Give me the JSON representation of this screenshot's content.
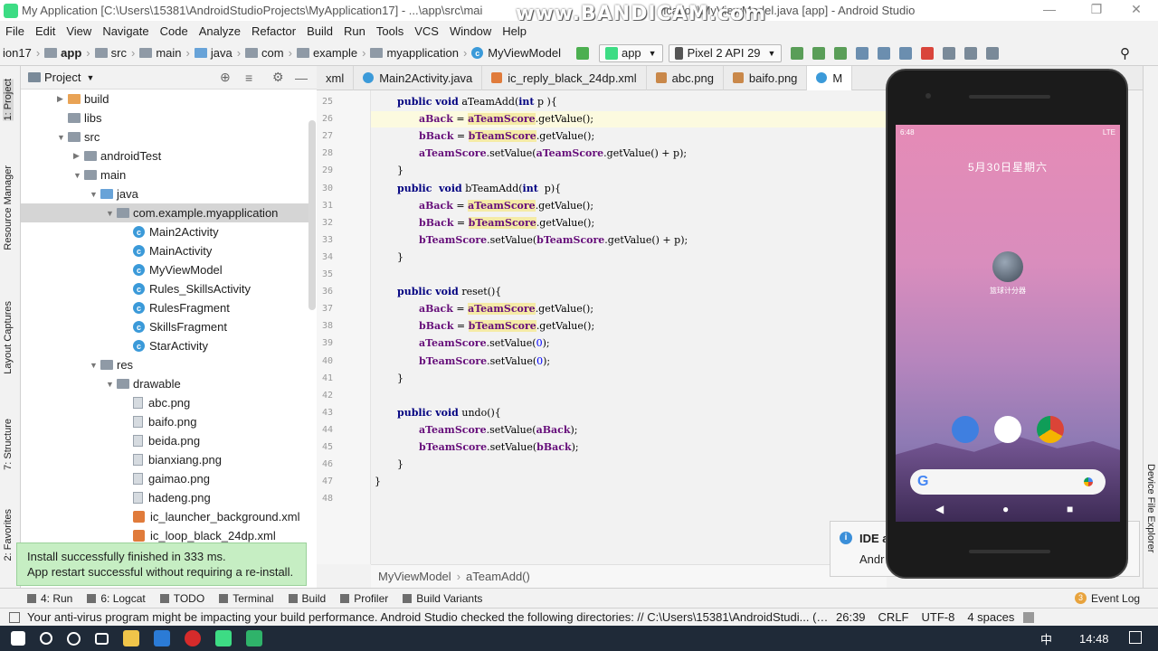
{
  "window": {
    "title": "My Application [C:\\Users\\15381\\AndroidStudioProjects\\MyApplication17] - ...\\app\\src\\main\\java\\com\\example\\myapplication\\MyViewModel.java [app] - Android Studio",
    "title_left": "My Application [C:\\Users\\15381\\AndroidStudioProjects\\MyApplication17] - ...\\app\\src\\mai",
    "title_right": "ication\\MyViewModel.java [app] - Android Studio",
    "watermark": "www.BANDICAM.com"
  },
  "menu": [
    "File",
    "Edit",
    "View",
    "Navigate",
    "Code",
    "Analyze",
    "Refactor",
    "Build",
    "Run",
    "Tools",
    "VCS",
    "Window",
    "Help"
  ],
  "nav": {
    "crumbs": [
      "ion17",
      "app",
      "src",
      "main",
      "java",
      "com",
      "example",
      "myapplication",
      "MyViewModel"
    ],
    "run_config": "app",
    "device": "Pixel 2 API 29"
  },
  "left_tool_tabs": [
    "1: Project",
    "Resource Manager",
    "Layout Captures",
    "7: Structure",
    "2: Favorites"
  ],
  "project_panel": {
    "title": "Project",
    "rows": [
      {
        "label": "build",
        "indent": 0,
        "kind": "folder-orange",
        "arrow": "▶"
      },
      {
        "label": "libs",
        "indent": 0,
        "kind": "folder",
        "arrow": ""
      },
      {
        "label": "src",
        "indent": 0,
        "kind": "folder",
        "arrow": "▼"
      },
      {
        "label": "androidTest",
        "indent": 1,
        "kind": "folder",
        "arrow": "▶"
      },
      {
        "label": "main",
        "indent": 1,
        "kind": "folder",
        "arrow": "▼"
      },
      {
        "label": "java",
        "indent": 2,
        "kind": "folder-blue",
        "arrow": "▼"
      },
      {
        "label": "com.example.myapplication",
        "indent": 3,
        "kind": "folder",
        "arrow": "▼"
      },
      {
        "label": "Main2Activity",
        "indent": 4,
        "kind": "class",
        "arrow": ""
      },
      {
        "label": "MainActivity",
        "indent": 4,
        "kind": "class",
        "arrow": ""
      },
      {
        "label": "MyViewModel",
        "indent": 4,
        "kind": "class",
        "arrow": ""
      },
      {
        "label": "Rules_SkillsActivity",
        "indent": 4,
        "kind": "class",
        "arrow": ""
      },
      {
        "label": "RulesFragment",
        "indent": 4,
        "kind": "class",
        "arrow": ""
      },
      {
        "label": "SkillsFragment",
        "indent": 4,
        "kind": "class",
        "arrow": ""
      },
      {
        "label": "StarActivity",
        "indent": 4,
        "kind": "class",
        "arrow": ""
      },
      {
        "label": "res",
        "indent": 2,
        "kind": "folder",
        "arrow": "▼"
      },
      {
        "label": "drawable",
        "indent": 3,
        "kind": "folder",
        "arrow": "▼"
      },
      {
        "label": "abc.png",
        "indent": 4,
        "kind": "file",
        "arrow": ""
      },
      {
        "label": "baifo.png",
        "indent": 4,
        "kind": "file",
        "arrow": ""
      },
      {
        "label": "beida.png",
        "indent": 4,
        "kind": "file",
        "arrow": ""
      },
      {
        "label": "bianxiang.png",
        "indent": 4,
        "kind": "file",
        "arrow": ""
      },
      {
        "label": "gaimao.png",
        "indent": 4,
        "kind": "file",
        "arrow": ""
      },
      {
        "label": "hadeng.png",
        "indent": 4,
        "kind": "file",
        "arrow": ""
      },
      {
        "label": "ic_launcher_background.xml",
        "indent": 4,
        "kind": "xml",
        "arrow": ""
      },
      {
        "label": "ic_loop_black_24dp.xml",
        "indent": 4,
        "kind": "xml",
        "arrow": ""
      }
    ]
  },
  "toast": {
    "line1": "Install successfully finished in 333 ms.",
    "line2": "App restart successful without requiring a re-install."
  },
  "editor_tabs": [
    {
      "label": "xml",
      "kind": "xml"
    },
    {
      "label": "Main2Activity.java",
      "kind": "class"
    },
    {
      "label": "ic_reply_black_24dp.xml",
      "kind": "xml"
    },
    {
      "label": "abc.png",
      "kind": "img"
    },
    {
      "label": "baifo.png",
      "kind": "img"
    },
    {
      "label": "M",
      "kind": "class"
    }
  ],
  "code_lines": [
    {
      "n": "25",
      "html": "<span class=\"kw\">public void</span> aTeamAdd(<span class=\"kw\">int</span> p ){",
      "indent": 0
    },
    {
      "n": "26",
      "html": "<span class=\"fld\">aBack</span> = <span class=\"fld hl\">aTeamScore</span>.getValue();",
      "indent": 1
    },
    {
      "n": "27",
      "html": "<span class=\"fld\">bBack</span> = <span class=\"fld hl\">bTeamScore</span>.getValue();",
      "indent": 1
    },
    {
      "n": "28",
      "html": "<span class=\"fld\">aTeamScore</span>.setValue(<span class=\"fld\">aTeamScore</span>.getValue() + p);",
      "indent": 1
    },
    {
      "n": "29",
      "html": "}",
      "indent": 0
    },
    {
      "n": "30",
      "html": "<span class=\"kw\">public  void</span> bTeamAdd(<span class=\"kw\">int</span>  p){",
      "indent": 0
    },
    {
      "n": "31",
      "html": "<span class=\"fld\">aBack</span> = <span class=\"fld hl\">aTeamScore</span>.getValue();",
      "indent": 1
    },
    {
      "n": "32",
      "html": "<span class=\"fld\">bBack</span> = <span class=\"fld hl\">bTeamScore</span>.getValue();",
      "indent": 1
    },
    {
      "n": "33",
      "html": "<span class=\"fld\">bTeamScore</span>.setValue(<span class=\"fld\">bTeamScore</span>.getValue() + p);",
      "indent": 1
    },
    {
      "n": "34",
      "html": "}",
      "indent": 0
    },
    {
      "n": "35",
      "html": "",
      "indent": 0
    },
    {
      "n": "36",
      "html": "<span class=\"kw\">public void</span> reset(){",
      "indent": 0
    },
    {
      "n": "37",
      "html": "<span class=\"fld\">aBack</span> = <span class=\"fld hl\">aTeamScore</span>.getValue();",
      "indent": 1
    },
    {
      "n": "38",
      "html": "<span class=\"fld\">bBack</span> = <span class=\"fld hl\">bTeamScore</span>.getValue();",
      "indent": 1
    },
    {
      "n": "39",
      "html": "<span class=\"fld\">aTeamScore</span>.setValue(<span class=\"num\">0</span>);",
      "indent": 1
    },
    {
      "n": "40",
      "html": "<span class=\"fld\">bTeamScore</span>.setValue(<span class=\"num\">0</span>);",
      "indent": 1
    },
    {
      "n": "41",
      "html": "}",
      "indent": 0
    },
    {
      "n": "42",
      "html": "",
      "indent": 0
    },
    {
      "n": "43",
      "html": "<span class=\"kw\">public void</span> undo(){",
      "indent": 0
    },
    {
      "n": "44",
      "html": "<span class=\"fld\">aTeamScore</span>.setValue(<span class=\"fld\">aBack</span>);",
      "indent": 1
    },
    {
      "n": "45",
      "html": "<span class=\"fld\">bTeamScore</span>.setValue(<span class=\"fld\">bBack</span>);",
      "indent": 1
    },
    {
      "n": "46",
      "html": "}",
      "indent": 0
    },
    {
      "n": "47",
      "html": "}",
      "indent": -1
    },
    {
      "n": "48",
      "html": "",
      "indent": 0
    }
  ],
  "editor_breadcrumb": {
    "class_name": "MyViewModel",
    "method": "aTeamAdd()"
  },
  "right_tool_tabs": [
    "Device File Explorer"
  ],
  "notification": {
    "title": "IDE a",
    "body": "Andr"
  },
  "bottom_tabs": [
    {
      "label": "4: Run",
      "icon": "run-icon"
    },
    {
      "label": "6: Logcat",
      "icon": "logcat-icon"
    },
    {
      "label": "TODO",
      "icon": "todo-icon"
    },
    {
      "label": "Terminal",
      "icon": "terminal-icon"
    },
    {
      "label": "Build",
      "icon": "build-icon"
    },
    {
      "label": "Profiler",
      "icon": "profiler-icon"
    },
    {
      "label": "Build Variants",
      "icon": "build-variants-icon"
    }
  ],
  "event_log": {
    "count": "3",
    "label": "Event Log"
  },
  "status": {
    "message": "Your anti-virus program might be impacting your build performance. Android Studio checked the following directories: // C:\\Users\\15381\\AndroidStudi... (3 minutes ago)",
    "position": "26:39",
    "line_sep": "CRLF",
    "encoding": "UTF-8",
    "indent": "4 spaces"
  },
  "taskbar": {
    "time": "14:48",
    "lang": "中"
  },
  "phone": {
    "time": "6:48",
    "signal": "LTE",
    "date": "5月30日星期六",
    "app_label": "篮球计分器"
  },
  "colors": {
    "accent_green": "#3ddc84",
    "toast_bg": "#c6eec3",
    "keyword": "#000080",
    "field": "#660e7a"
  }
}
